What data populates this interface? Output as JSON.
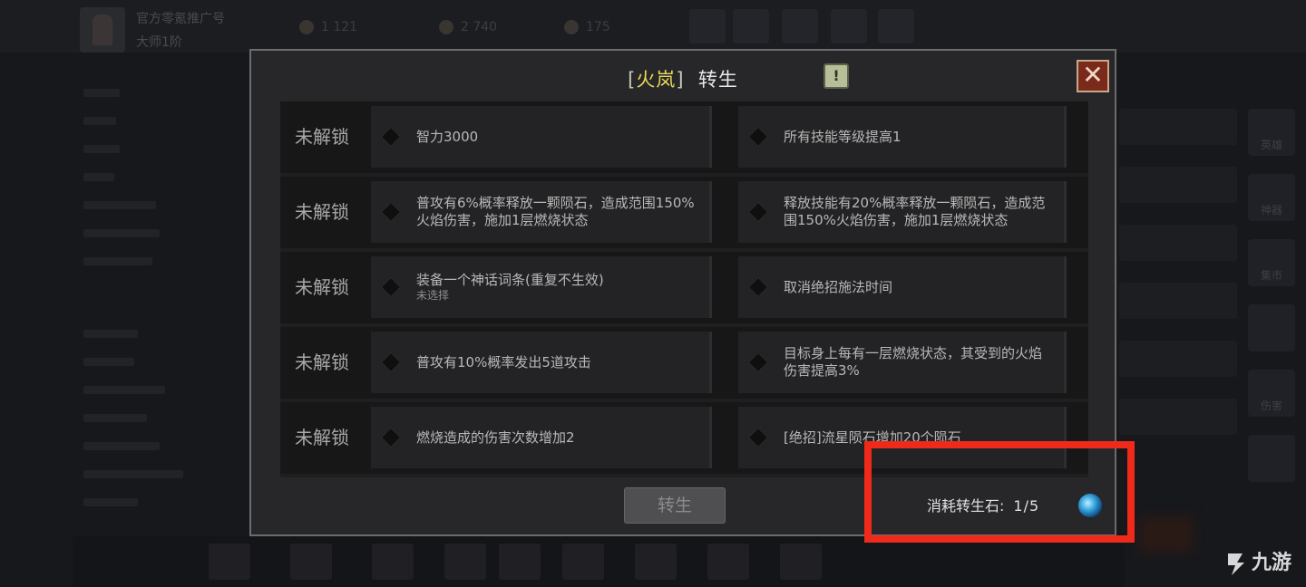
{
  "background": {
    "player_name": "官方零氪推广号",
    "player_rank": "大师1阶",
    "stats": [
      "1 121",
      "2 740",
      "175"
    ],
    "side_buttons": [
      "英雄",
      "神器",
      "集市",
      "",
      "伤害",
      ""
    ]
  },
  "dialog": {
    "title_bracket_open": "[",
    "hero_name": "火岚",
    "title_bracket_close": "]",
    "title_suffix": "转生",
    "help_label": "!",
    "close_label": "✕",
    "rows": [
      {
        "status": "未解锁",
        "left": {
          "text": "智力3000",
          "sub": ""
        },
        "right": {
          "text": "所有技能等级提高1",
          "sub": ""
        }
      },
      {
        "status": "未解锁",
        "left": {
          "text": "普攻有6%概率释放一颗陨石，造成范围150%火焰伤害，施加1层燃烧状态",
          "sub": ""
        },
        "right": {
          "text": "释放技能有20%概率释放一颗陨石，造成范围150%火焰伤害，施加1层燃烧状态",
          "sub": ""
        }
      },
      {
        "status": "未解锁",
        "left": {
          "text": "装备一个神话词条(重复不生效)",
          "sub": "未选择"
        },
        "right": {
          "text": "取消绝招施法时间",
          "sub": ""
        }
      },
      {
        "status": "未解锁",
        "left": {
          "text": "普攻有10%概率发出5道攻击",
          "sub": ""
        },
        "right": {
          "text": "目标身上每有一层燃烧状态，其受到的火焰伤害提高3%",
          "sub": ""
        }
      },
      {
        "status": "未解锁",
        "left": {
          "text": "燃烧造成的伤害次数增加2",
          "sub": ""
        },
        "right": {
          "text": "[绝招]流星陨石增加20个陨石",
          "sub": ""
        }
      }
    ],
    "rebirth_button": "转生",
    "cost_label": "消耗转生石:",
    "cost_value": "1/5",
    "cost_icon": "rebirth-stone-icon"
  },
  "watermark": {
    "text": "九游"
  },
  "colors": {
    "highlight": "#f02a1a",
    "hero_name": "#e8d85a"
  }
}
